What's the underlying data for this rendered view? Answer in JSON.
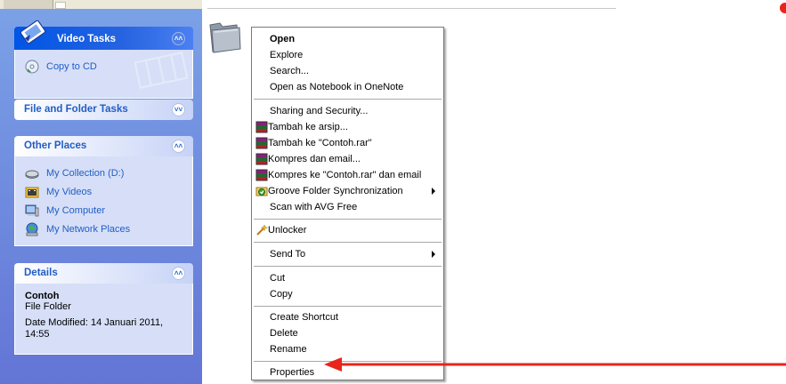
{
  "task_pane": {
    "video_tasks": {
      "title": "Video Tasks",
      "items": [
        {
          "label": "Copy to CD",
          "icon": "cd-copy-icon"
        }
      ]
    },
    "file_folder_tasks": {
      "title": "File and Folder Tasks"
    },
    "other_places": {
      "title": "Other Places",
      "items": [
        {
          "label": "My Collection (D:)",
          "icon": "drive-icon"
        },
        {
          "label": "My Videos",
          "icon": "videos-folder-icon"
        },
        {
          "label": "My Computer",
          "icon": "computer-icon"
        },
        {
          "label": "My Network Places",
          "icon": "network-icon"
        }
      ]
    },
    "details": {
      "title": "Details",
      "name": "Contoh",
      "type": "File Folder",
      "modified_line1": "Date Modified: 14 Januari 2011,",
      "modified_line2": "14:55"
    }
  },
  "context_menu": {
    "items": [
      {
        "label": "Open"
      },
      {
        "label": "Explore"
      },
      {
        "label": "Search..."
      },
      {
        "label": "Open as Notebook in OneNote"
      },
      {
        "label": "Sharing and Security..."
      },
      {
        "label": "Tambah ke arsip..."
      },
      {
        "label": "Tambah ke \"Contoh.rar\""
      },
      {
        "label": "Kompres dan email..."
      },
      {
        "label": "Kompres ke \"Contoh.rar\" dan email"
      },
      {
        "label": "Groove Folder Synchronization"
      },
      {
        "label": "Scan with AVG Free"
      },
      {
        "label": "Unlocker"
      },
      {
        "label": "Send To"
      },
      {
        "label": "Cut"
      },
      {
        "label": "Copy"
      },
      {
        "label": "Create Shortcut"
      },
      {
        "label": "Delete"
      },
      {
        "label": "Rename"
      },
      {
        "label": "Properties"
      }
    ]
  },
  "colors": {
    "pane_top": "#7ba2e7",
    "pane_bottom": "#6375d6",
    "link_blue": "#215dc6",
    "annotation_red": "#e8241c"
  }
}
